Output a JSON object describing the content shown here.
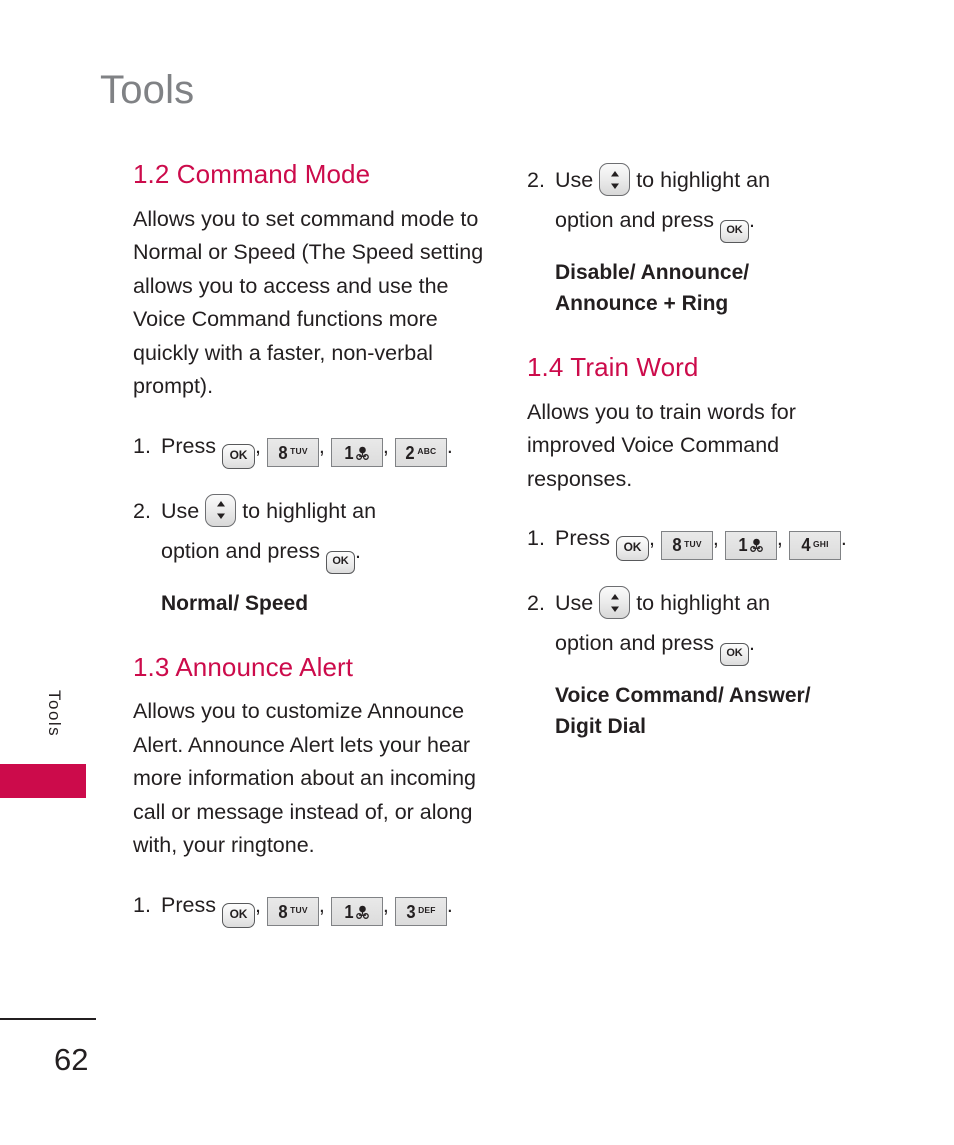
{
  "page": {
    "title": "Tools",
    "side_tab_label": "Tools",
    "side_tab_color": "#cc0b4b",
    "number": "62",
    "accent_color": "#cc0b4b",
    "text_color": "#231f20",
    "title_color": "#808285"
  },
  "left_column": {
    "sections": [
      {
        "heading": "1.2 Command Mode",
        "body": "Allows you to set command mode to Normal or Speed (The Speed setting allows you to access and use the Voice Command functions more quickly with a faster, non-verbal prompt).",
        "steps": [
          {
            "number": "1.",
            "verb": "Press",
            "keys": [
              "OK",
              "8 TUV",
              "1 voicemail",
              "2 ABC"
            ],
            "key_specs": [
              {
                "type": "ok",
                "label": "OK"
              },
              {
                "type": "num",
                "digit": "8",
                "sub": "TUV"
              },
              {
                "type": "num",
                "digit": "1",
                "sub": "voicemail-icon"
              },
              {
                "type": "num",
                "digit": "2",
                "sub": "ABC"
              }
            ],
            "trailing": "."
          },
          {
            "number": "2.",
            "line1_prefix": "Use",
            "line1_suffix": "to highlight an",
            "line2_prefix": "option and press",
            "line2_suffix": ".",
            "nav_key": "up-down-navigation",
            "ok_key": "OK"
          }
        ],
        "options": "Normal/ Speed"
      },
      {
        "heading": "1.3 Announce Alert",
        "body": "Allows you to customize Announce Alert. Announce Alert lets your hear more information about an incoming call or message instead of, or along with, your ringtone.",
        "steps": [
          {
            "number": "1.",
            "verb": "Press",
            "keys": [
              "OK",
              "8 TUV",
              "1 voicemail",
              "3 DEF"
            ],
            "key_specs": [
              {
                "type": "ok",
                "label": "OK"
              },
              {
                "type": "num",
                "digit": "8",
                "sub": "TUV"
              },
              {
                "type": "num",
                "digit": "1",
                "sub": "voicemail-icon"
              },
              {
                "type": "num",
                "digit": "3",
                "sub": "DEF"
              }
            ],
            "trailing": "."
          }
        ],
        "options": null
      }
    ]
  },
  "right_column": {
    "continued_step": {
      "number": "2.",
      "line1_prefix": "Use",
      "line1_suffix": "to highlight an",
      "line2_prefix": "option and press",
      "line2_suffix": ".",
      "nav_key": "up-down-navigation",
      "ok_key": "OK"
    },
    "continued_options_line1": "Disable/ Announce/",
    "continued_options_line2": "Announce + Ring",
    "sections": [
      {
        "heading": "1.4 Train Word",
        "body": "Allows you to train words for improved Voice Command responses.",
        "steps": [
          {
            "number": "1.",
            "verb": "Press",
            "keys": [
              "OK",
              "8 TUV",
              "1 voicemail",
              "4 GHI"
            ],
            "key_specs": [
              {
                "type": "ok",
                "label": "OK"
              },
              {
                "type": "num",
                "digit": "8",
                "sub": "TUV"
              },
              {
                "type": "num",
                "digit": "1",
                "sub": "voicemail-icon"
              },
              {
                "type": "num",
                "digit": "4",
                "sub": "GHI"
              }
            ],
            "trailing": "."
          },
          {
            "number": "2.",
            "line1_prefix": "Use",
            "line1_suffix": "to highlight an",
            "line2_prefix": "option and press",
            "line2_suffix": ".",
            "nav_key": "up-down-navigation",
            "ok_key": "OK"
          }
        ],
        "options_line1": "Voice Command/ Answer/",
        "options_line2": "Digit Dial"
      }
    ]
  },
  "key_labels": {
    "ok": "OK",
    "tuv": "TUV",
    "abc": "ABC",
    "def": "DEF",
    "ghi": "GHI",
    "d8": "8",
    "d1": "1",
    "d2": "2",
    "d3": "3",
    "d4": "4"
  },
  "punctuation": {
    "comma": ",",
    "period": "."
  }
}
